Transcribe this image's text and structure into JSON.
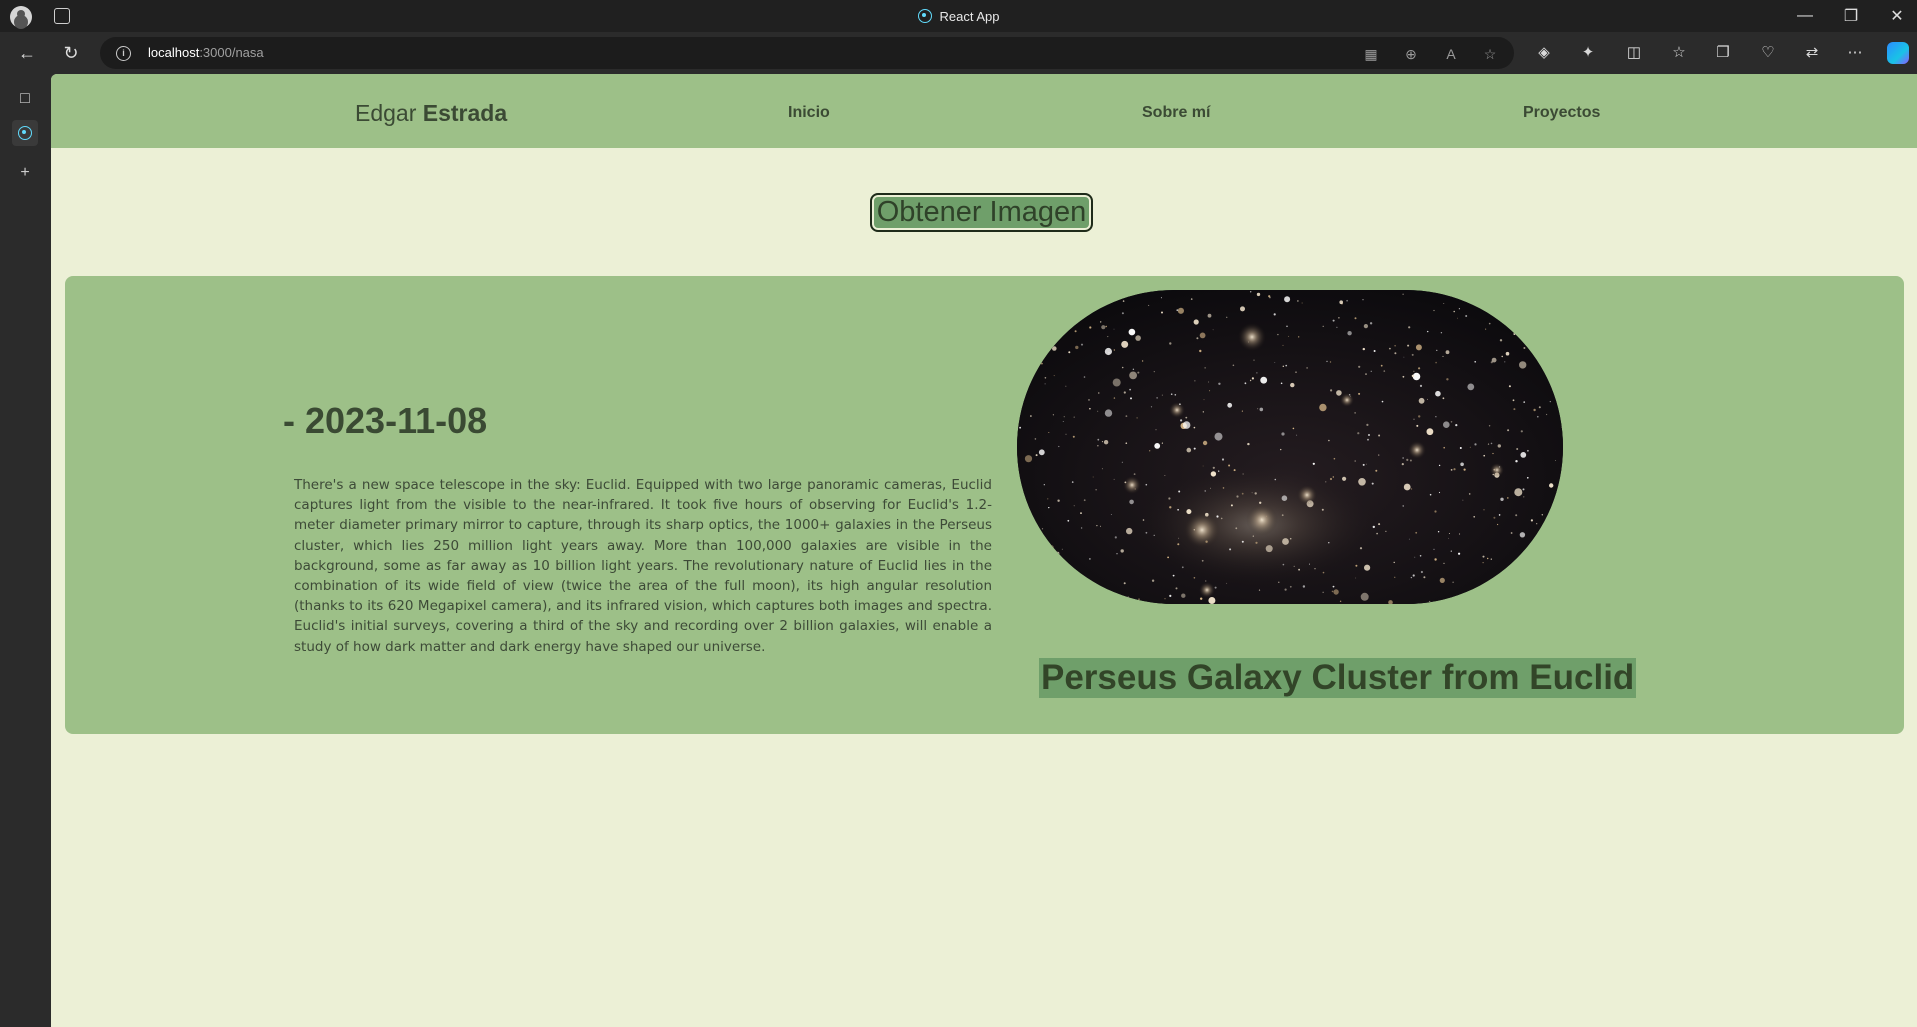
{
  "window": {
    "title": "React App"
  },
  "browser": {
    "url_host": "localhost",
    "url_path": ":3000/nasa"
  },
  "site": {
    "brand_first": "Edgar",
    "brand_last": "Estrada",
    "nav": [
      "Inicio",
      "Sobre mí",
      "Proyectos"
    ]
  },
  "main": {
    "button_label": "Obtener Imagen",
    "date": "- 2023-11-08",
    "explanation": "There's a new space telescope in the sky: Euclid. Equipped with two large panoramic cameras, Euclid captures light from the visible to the near-infrared. It took five hours of observing for Euclid's 1.2-meter diameter primary mirror to capture, through its sharp optics, the 1000+ galaxies in the Perseus cluster, which lies 250 million light years away. More than 100,000 galaxies are visible in the background, some as far away as 10 billion light years. The revolutionary nature of Euclid lies in the combination of its wide field of view (twice the area of the full moon), its high angular resolution (thanks to its 620 Megapixel camera), and its infrared vision, which captures both images and spectra. Euclid's initial surveys, covering a third of the sky and recording over 2 billion galaxies, will enable a study of how dark matter and dark energy have shaped our universe.",
    "image_title": "Perseus Galaxy Cluster from Euclid"
  },
  "colors": {
    "page_bg": "#ecf0d6",
    "header_bg": "#9dc088",
    "button_bg": "#6f9f6a",
    "text_dark": "#3a4a33"
  }
}
